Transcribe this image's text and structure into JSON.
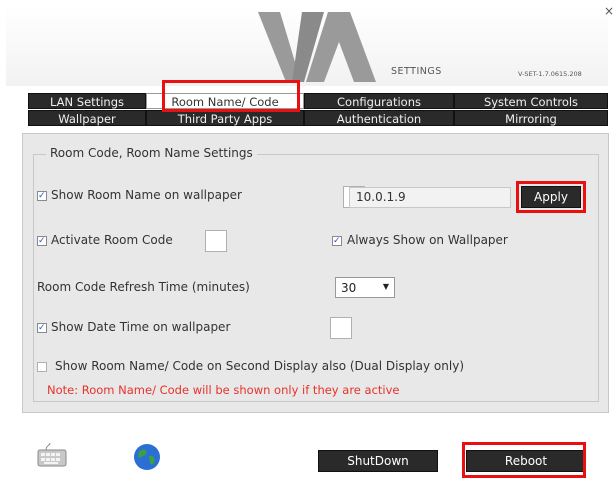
{
  "header": {
    "settings_label": "SETTINGS",
    "version": "V-SET-1.7.0615.208",
    "close_glyph": "×",
    "logo_text": "VIA"
  },
  "tabs": [
    {
      "label": "LAN Settings"
    },
    {
      "label": "Room Name/ Code",
      "active": true
    },
    {
      "label": "Configurations"
    },
    {
      "label": "System Controls"
    },
    {
      "label": "Wallpaper"
    },
    {
      "label": "Third Party Apps"
    },
    {
      "label": "Authentication"
    },
    {
      "label": "Mirroring"
    }
  ],
  "group": {
    "title": "Room Code, Room Name Settings"
  },
  "options": {
    "show_room_name": {
      "label": "Show Room Name on wallpaper",
      "checked": true
    },
    "ip_value": "10.0.1.9",
    "apply_label": "Apply",
    "activate_room_code": {
      "label": "Activate Room Code",
      "checked": true
    },
    "always_show": {
      "label": "Always Show on Wallpaper",
      "checked": true
    },
    "refresh_label": "Room Code Refresh Time (minutes)",
    "refresh_value": "30",
    "show_date_time": {
      "label": "Show Date Time on wallpaper",
      "checked": true
    },
    "second_display": {
      "label": "Show Room Name/ Code on Second Display also (Dual Display only)",
      "checked": false
    },
    "check_glyph": "✓"
  },
  "note": "Note: Room Name/ Code will be shown only if they are active",
  "footer": {
    "icons": [
      "keyboard-icon",
      "globe-icon"
    ],
    "shutdown_label": "ShutDown",
    "reboot_label": "Reboot"
  },
  "colors": {
    "highlight": "#e81010",
    "note": "#e8322b",
    "tab_bg": "#2a2a2a",
    "check": "#2b57c6"
  }
}
